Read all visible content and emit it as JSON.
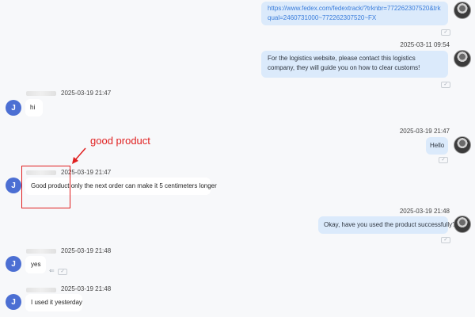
{
  "messages": [
    {
      "id": "m1",
      "direction": "outgoing",
      "link_text": "https://www.fedex.com/fedextrack/?trknbr=772262307520&trkqual=2460731000~772262307520~FX"
    },
    {
      "id": "m2",
      "direction": "outgoing",
      "timestamp": "2025-03-11 09:54",
      "text": "For the logistics website, please contact this logistics company, they will guide you on how to clear customs!"
    },
    {
      "id": "m3",
      "direction": "incoming",
      "sender_initial": "J",
      "timestamp": "2025-03-19 21:47",
      "text": "hi"
    },
    {
      "id": "m4",
      "direction": "outgoing",
      "timestamp": "2025-03-19 21:47",
      "text": "Hello"
    },
    {
      "id": "m5",
      "direction": "incoming",
      "sender_initial": "J",
      "timestamp": "2025-03-19 21:47",
      "text": "Good product only the next order can make it 5 centimeters longer"
    },
    {
      "id": "m6",
      "direction": "outgoing",
      "timestamp": "2025-03-19 21:48",
      "text": "Okay, have you used the product successfully?"
    },
    {
      "id": "m7",
      "direction": "incoming",
      "sender_initial": "J",
      "timestamp": "2025-03-19 21:48",
      "text": "yes"
    },
    {
      "id": "m8",
      "direction": "incoming",
      "sender_initial": "J",
      "timestamp": "2025-03-19 21:48",
      "text": "I used it yesterday"
    }
  ],
  "annotation": {
    "label": "good product",
    "color": "#e02020"
  },
  "colors": {
    "outgoing_bubble": "#dbeafb",
    "incoming_bubble": "#ffffff",
    "avatar": "#4c6fd3",
    "link": "#3a7ddb"
  },
  "icons": {
    "read_receipt": "read-receipt-icon",
    "reply": "reply-icon"
  }
}
